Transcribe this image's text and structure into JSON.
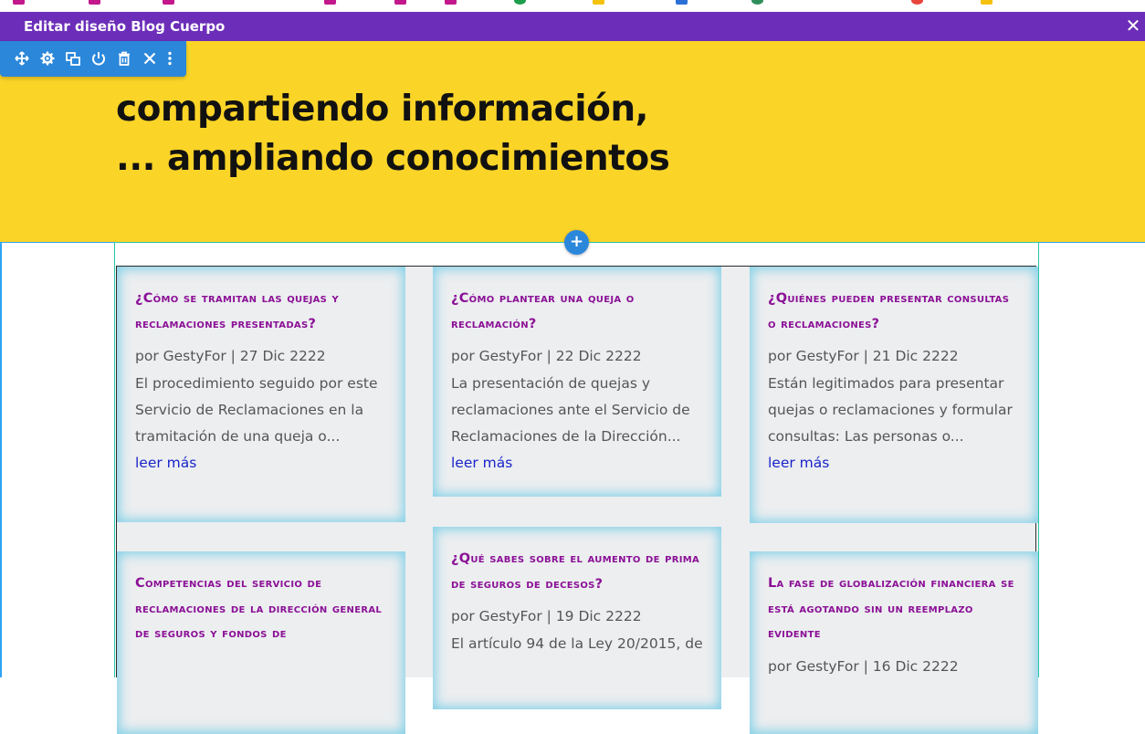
{
  "editor": {
    "title": "Editar diseño Blog Cuerpo",
    "close_label": "✕"
  },
  "toolbar": {
    "items": [
      "move-icon",
      "gear-icon",
      "duplicate-icon",
      "power-icon",
      "trash-icon",
      "close-icon",
      "more-icon"
    ]
  },
  "hero": {
    "line1": "compartiendo información,",
    "line2": "... ampliando conocimientos"
  },
  "add_button": "+",
  "posts": [
    {
      "title": "¿Cómo se tramitan las quejas y reclamaciones presentadas?",
      "meta": "por GestyFor | 27 Dic 2222",
      "excerpt": "El procedimiento seguido por este Servicio de Reclamaciones en la tramitación de una queja o...",
      "more": "leer más"
    },
    {
      "title": "¿Cómo plantear una queja o reclamación?",
      "meta": "por GestyFor | 22 Dic 2222",
      "excerpt": "La presentación de quejas y reclamaciones ante el Servicio de Reclamaciones de la Dirección...",
      "more": "leer más"
    },
    {
      "title": "¿Quiénes pueden presentar consultas o reclamaciones?",
      "meta": "por GestyFor | 21 Dic 2222",
      "excerpt": "Están legitimados para presentar quejas o reclamaciones y formular consultas: Las personas o...",
      "more": "leer más"
    },
    {
      "title": "Competencias del servicio de reclamaciones de la Dirección General de Seguros y Fondos de",
      "meta": "",
      "excerpt": "",
      "more": ""
    },
    {
      "title": "¿Qué sabes sobre el aumento de prima de seguros de decesos?",
      "meta": "por GestyFor | 19 Dic 2222",
      "excerpt": "El artículo 94 de la Ley 20/2015, de",
      "more": ""
    },
    {
      "title": "La fase de globalización financiera se está agotando sin un reemplazo evidente",
      "meta": "por GestyFor | 16 Dic 2222",
      "excerpt": "",
      "more": ""
    }
  ],
  "colors": {
    "editor_bar": "#6c2eb9",
    "hero_bg": "#fbd428",
    "toolbar": "#2b87da",
    "title": "#8b1096",
    "link": "#1a24c9"
  }
}
